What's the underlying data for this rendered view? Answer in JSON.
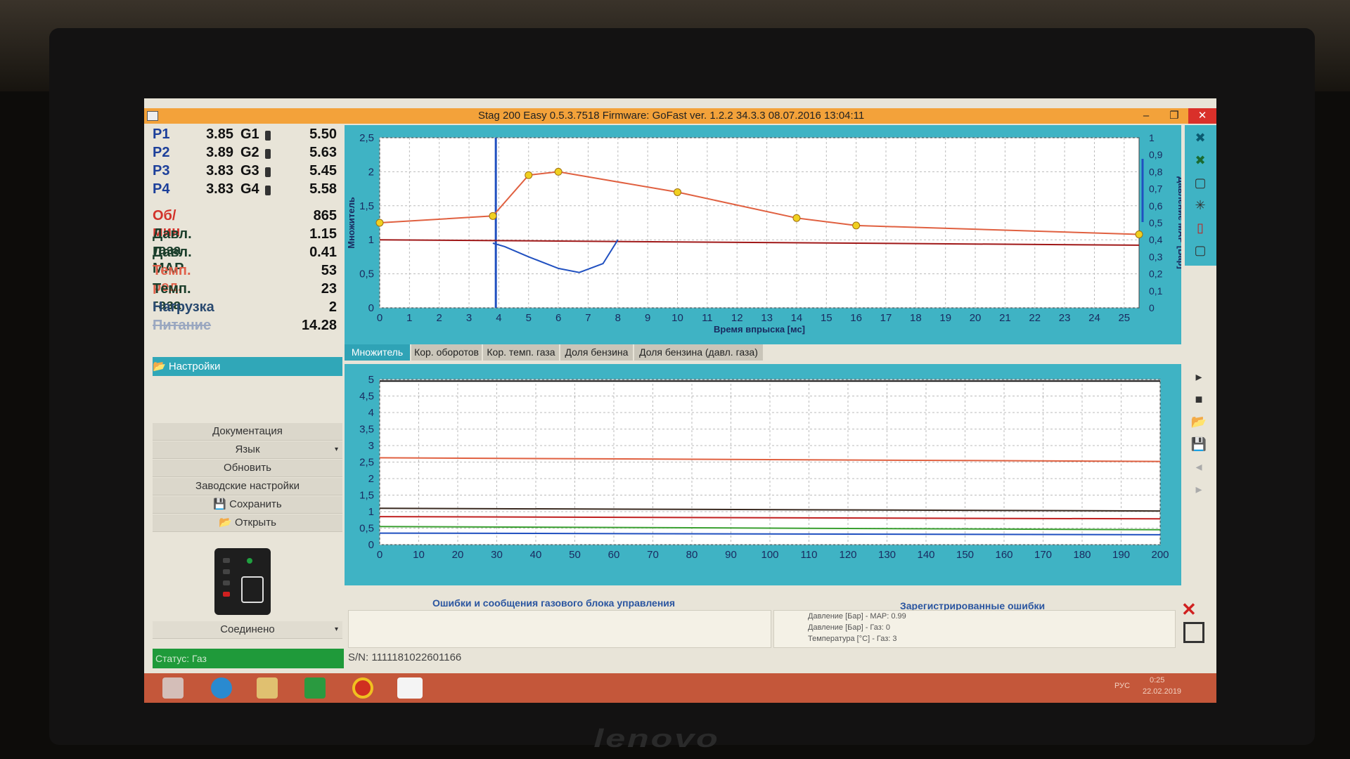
{
  "titlebar": {
    "title": "Stag 200 Easy 0.5.3.7518 Firmware: GoFast  ver. 1.2.2  34.3.3   08.07.2016 13:04:11",
    "min": "–",
    "max": "❐",
    "close": "✕"
  },
  "injectors": [
    {
      "p": "P1",
      "pv": "3.85",
      "g": "G1",
      "gv": "5.50"
    },
    {
      "p": "P2",
      "pv": "3.89",
      "g": "G2",
      "gv": "5.63"
    },
    {
      "p": "P3",
      "pv": "3.83",
      "g": "G3",
      "gv": "5.45"
    },
    {
      "p": "P4",
      "pv": "3.83",
      "g": "G4",
      "gv": "5.58"
    }
  ],
  "params": [
    {
      "label": "Об/мин",
      "value": "865",
      "color": "#d2322a"
    },
    {
      "label": "Давл. газа",
      "value": "1.15",
      "color": "#1a3d2a"
    },
    {
      "label": "Давл. MAP",
      "value": "0.41",
      "color": "#1a3d2a"
    },
    {
      "label": "Темп. ред.",
      "value": "53",
      "color": "#e0604a"
    },
    {
      "label": "Темп. газа",
      "value": "23",
      "color": "#1a3d2a"
    },
    {
      "label": "Нагрузка",
      "value": "2",
      "color": "#2a4a70"
    },
    {
      "label": "Питание",
      "value": "14.28",
      "color": "#9aa7c0"
    }
  ],
  "settings": {
    "title": "Настройки"
  },
  "menu": {
    "docs": "Документация",
    "lang": "Язык",
    "update": "Обновить",
    "factory": "Заводские настройки",
    "save": "Сохранить",
    "open": "Открыть",
    "connected": "Соединено"
  },
  "status": "Статус: Газ",
  "sn": "S/N: 1111181022601166",
  "tabs": [
    "Множитель",
    "Кор. оборотов",
    "Кор. темп. газа",
    "Доля бензина",
    "Доля бензина (давл. газа)"
  ],
  "messages": {
    "left_title": "Ошибки и сообщения газового блока управления",
    "right_title": "Зарегистрированные ошибки",
    "errors": [
      "Давление [Бар] - MAP: 0.99",
      "Давление [Бар] - Газ: 0",
      "Температура [°C] - Газ: 3"
    ]
  },
  "tray": {
    "lang": "РУС",
    "time": "0:25",
    "date": "22.02.2019"
  },
  "colors": {
    "accent": "#3fb3c4",
    "titlebar": "#f3a23a",
    "taskbar": "#c4573a",
    "status": "#1f9a3a"
  },
  "chart_data": [
    {
      "type": "line",
      "title": "",
      "xlabel": "Время впрыска [мс]",
      "ylabel": "Множитель",
      "y2label": "Давление MAP [Бар]",
      "xlim": [
        0,
        25.5
      ],
      "ylim": [
        0,
        2.5
      ],
      "y2lim": [
        0,
        1
      ],
      "xticks": [
        0,
        1,
        2,
        3,
        4,
        5,
        6,
        7,
        8,
        9,
        10,
        11,
        12,
        13,
        14,
        15,
        16,
        17,
        18,
        19,
        20,
        21,
        22,
        23,
        24,
        25
      ],
      "yticks": [
        "0",
        "0,5",
        "1",
        "1,5",
        "2",
        "2,5"
      ],
      "y2ticks": [
        "0",
        "0,1",
        "0,2",
        "0,3",
        "0,4",
        "0,5",
        "0,6",
        "0,7",
        "0,8",
        "0,9",
        "1"
      ],
      "series": [
        {
          "name": "multiplier",
          "color": "#e06040",
          "x": [
            0,
            3.8,
            5,
            6,
            10,
            14,
            16,
            25.5
          ],
          "y": [
            1.25,
            1.35,
            1.95,
            2.0,
            1.7,
            1.32,
            1.21,
            1.08
          ]
        },
        {
          "name": "ref",
          "color": "#a01818",
          "x": [
            0,
            25.5
          ],
          "y": [
            1.0,
            0.92
          ]
        },
        {
          "name": "blue",
          "color": "#2050c0",
          "x": [
            3.8,
            4.2,
            5,
            6,
            6.7,
            7.5,
            8
          ],
          "y": [
            0.95,
            0.9,
            0.75,
            0.58,
            0.52,
            0.65,
            1.0
          ]
        }
      ],
      "cursor_x": 3.9
    },
    {
      "type": "line",
      "title": "",
      "xlim": [
        0,
        200
      ],
      "ylim": [
        0,
        5
      ],
      "xticks": [
        0,
        10,
        20,
        30,
        40,
        50,
        60,
        70,
        80,
        90,
        100,
        110,
        120,
        130,
        140,
        150,
        160,
        170,
        180,
        190,
        200
      ],
      "yticks": [
        "0",
        "0,5",
        "1",
        "1,5",
        "2",
        "2,5",
        "3",
        "3,5",
        "4",
        "4,5",
        "5"
      ],
      "series": [
        {
          "name": "top",
          "color": "#111111",
          "x": [
            0,
            200
          ],
          "y": [
            4.95,
            4.95
          ]
        },
        {
          "name": "orange",
          "color": "#e06040",
          "x": [
            0,
            200
          ],
          "y": [
            2.63,
            2.52
          ]
        },
        {
          "name": "dark",
          "color": "#3a2a20",
          "x": [
            0,
            200
          ],
          "y": [
            1.1,
            1.02
          ]
        },
        {
          "name": "red",
          "color": "#c02020",
          "x": [
            0,
            200
          ],
          "y": [
            0.85,
            0.78
          ]
        },
        {
          "name": "green",
          "color": "#3aa030",
          "x": [
            0,
            200
          ],
          "y": [
            0.55,
            0.45
          ]
        },
        {
          "name": "blue",
          "color": "#2050c0",
          "x": [
            0,
            200
          ],
          "y": [
            0.35,
            0.3
          ]
        }
      ]
    }
  ]
}
